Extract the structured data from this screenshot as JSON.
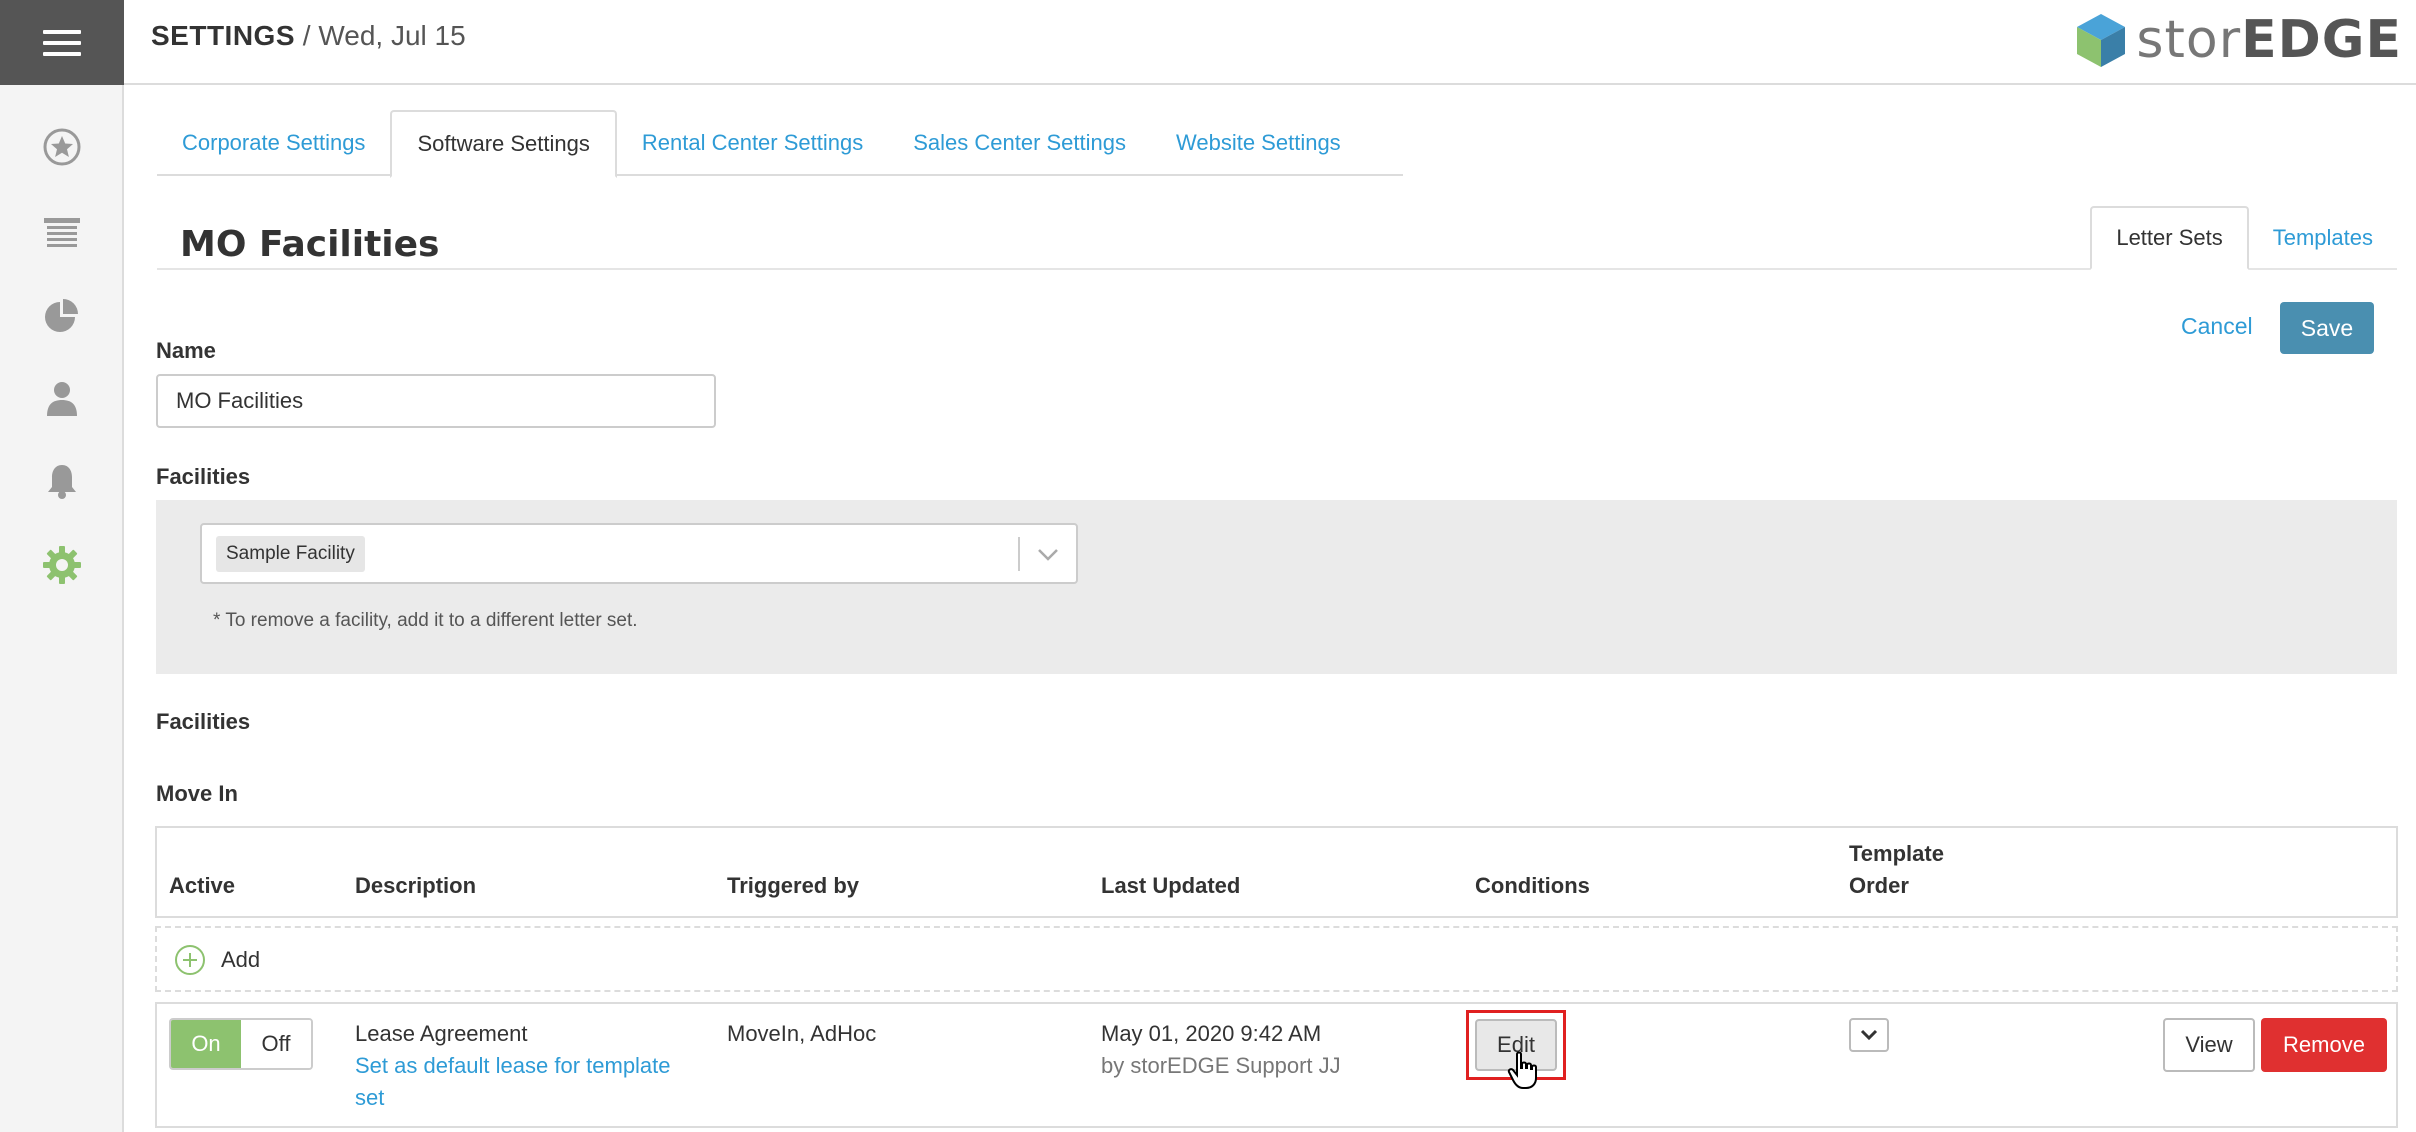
{
  "header": {
    "title": "SETTINGS",
    "separator": " / ",
    "date": "Wed, Jul 15",
    "logo_part1": "stor",
    "logo_part2": "EDGE"
  },
  "sidebar": {
    "items": [
      {
        "name": "star-icon"
      },
      {
        "name": "units-icon"
      },
      {
        "name": "reports-pie-icon"
      },
      {
        "name": "user-icon"
      },
      {
        "name": "bell-icon"
      },
      {
        "name": "gear-icon",
        "active": true
      }
    ],
    "active_color": "#8dc26f",
    "icon_color": "#999999"
  },
  "tabs": [
    {
      "label": "Corporate Settings"
    },
    {
      "label": "Software Settings",
      "active": true
    },
    {
      "label": "Rental Center Settings"
    },
    {
      "label": "Sales Center Settings"
    },
    {
      "label": "Website Settings"
    }
  ],
  "section": {
    "title": "MO Facilities",
    "subtabs": [
      {
        "label": "Letter Sets",
        "active": true
      },
      {
        "label": "Templates"
      }
    ]
  },
  "actions": {
    "cancel_label": "Cancel",
    "save_label": "Save"
  },
  "form": {
    "name_label": "Name",
    "name_value": "MO Facilities",
    "facilities_label": "Facilities",
    "selected_facility": "Sample Facility",
    "facility_note": "* To remove a facility, add it to a different letter set."
  },
  "facilities_heading": "Facilities",
  "move_in": {
    "heading": "Move In",
    "columns": {
      "active": "Active",
      "description": "Description",
      "triggered_by": "Triggered by",
      "last_updated": "Last Updated",
      "conditions": "Conditions",
      "template_order_1": "Template",
      "template_order_2": "Order"
    },
    "add_label": "Add",
    "rows": [
      {
        "toggle_on": "On",
        "toggle_off": "Off",
        "active": true,
        "description": "Lease Agreement",
        "default_link_1": "Set as default lease for template",
        "default_link_2": "set",
        "triggered_by": "MoveIn, AdHoc",
        "last_updated": "May 01, 2020 9:42 AM",
        "updated_by": "by storEDGE Support JJ",
        "edit_label": "Edit",
        "view_label": "View",
        "remove_label": "Remove"
      }
    ]
  },
  "colors": {
    "accent": "#2e9bd6",
    "save": "#4a8fb0",
    "remove": "#e03030",
    "toggle_on": "#8dc26f",
    "highlight": "#e02020"
  }
}
